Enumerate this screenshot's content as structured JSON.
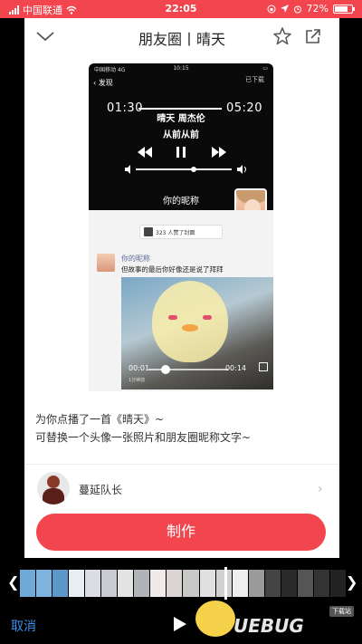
{
  "status_bar": {
    "carrier": "中国联通",
    "time": "22:05",
    "battery": "72%"
  },
  "nav": {
    "title": "朋友圈丨晴天"
  },
  "preview": {
    "status_carrier": "中国移动 4G",
    "status_time": "10:15",
    "back_label": "发现",
    "done_label": "已下载",
    "elapsed": "01:30",
    "remaining": "05:20",
    "song": "晴天 周杰伦",
    "lyric": "从前从前",
    "nickname": "你的昵称",
    "likes": "323 人赞了封面"
  },
  "post": {
    "name": "你的昵称",
    "text": "但故事的最后你好像还是说了拜拜",
    "video_elapsed": "00:01",
    "video_total": "00:14",
    "video_caption": "1分钟前"
  },
  "description": {
    "line1": "为你点播了一首《晴天》~",
    "line2": "可替换一个头像一张照片和朋友圈昵称文字~"
  },
  "author": {
    "name": "蔓延队长"
  },
  "make_button": "制作",
  "bottom": {
    "cancel": "取消",
    "watermark": "UEBUG",
    "watermark_tag": "下载站"
  },
  "colors": {
    "accent": "#f2454e",
    "link": "#3a8ff0"
  }
}
